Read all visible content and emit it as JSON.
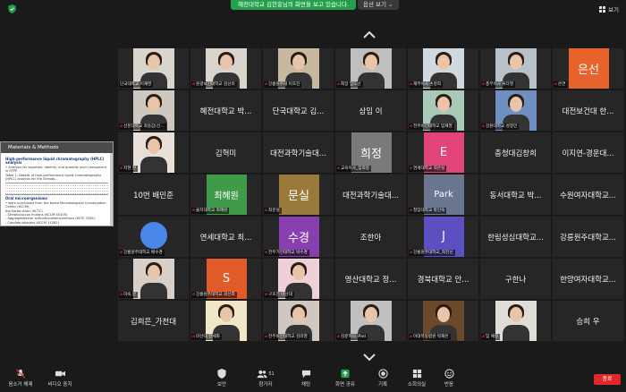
{
  "top": {
    "share_banner": "혜전대학교 김한흥님의 화면을 보고 있습니다.",
    "view_options": "옵션 보기 ⌄",
    "view_button": "보기"
  },
  "shared_screen": {
    "title": "Materials & Methods",
    "heading1": "High-performance liquid chromatography (HPLC) analysis",
    "line1": "• Analysis for separate, identify, and quantify each component in EFPP",
    "line2": "Table 1. Details of high-performance liquid chromatography (HPLC) analysis for the Strepto...",
    "heading2": "Oral microorganisms",
    "line3": "• were purchased from the Korea Microbiological Conservation Center (KCCM),",
    "line4": "the Korea strain (KCTC)",
    "line5": "- Streptococcus mutans (KCCM 40105)",
    "line6": "- Aggregatibacter actinomycetemcomitans (KCTC 2581)",
    "line7": "- Candida albicans (KCCM 11282)",
    "line8": "- Candida albicans (KCCM 11282)"
  },
  "tiles": [
    {
      "type": "photo",
      "label": "단국대학교 이재영",
      "muted": false
    },
    {
      "type": "photo",
      "label": "원광보건대학교 김선미",
      "muted": true
    },
    {
      "type": "photo",
      "label": "강릉원주대 이호진",
      "muted": true,
      "bg": "#c9b8a0"
    },
    {
      "type": "photo",
      "label": "회장 임도선",
      "muted": true,
      "bg": "#bfbfbf"
    },
    {
      "type": "photo",
      "label": "재무이사 손정희",
      "muted": true,
      "bg": "#d0d8e0"
    },
    {
      "type": "photo",
      "label": "총무이사 류다영",
      "muted": true,
      "bg": "#b8c0c8"
    },
    {
      "type": "square",
      "label": "은연",
      "muted": true,
      "letter": "은선",
      "bg": "#e8622b"
    },
    {
      "type": "photo",
      "label": "선문대학교 최용갑(신...",
      "muted": true,
      "bg": "#cfc8c0"
    },
    {
      "type": "name",
      "name": "혜전대학교 박...",
      "label": "",
      "muted": false
    },
    {
      "type": "name",
      "name": "단국대학교 김...",
      "label": "",
      "muted": false
    },
    {
      "type": "name",
      "name": "삼임 이",
      "label": "",
      "muted": false
    },
    {
      "type": "photo",
      "label": "전주비전대학교 임재영",
      "muted": true,
      "bg": "#a8c8b8"
    },
    {
      "type": "photo",
      "label": "강원대학교 성정민",
      "muted": true,
      "bg": "#6e8fbf"
    },
    {
      "type": "name",
      "name": "대전보건대 한...",
      "label": "",
      "muted": false
    },
    {
      "type": "photo",
      "label": "지현 한",
      "muted": true,
      "bg": "#e8e0d6"
    },
    {
      "type": "name",
      "name": "김혁미",
      "label": "",
      "muted": false
    },
    {
      "type": "name",
      "name": "대전과학기술대...",
      "label": "",
      "muted": false
    },
    {
      "type": "square",
      "label": "교육이사_임희정",
      "muted": true,
      "letter": "희정",
      "bg": "#7a7a7a"
    },
    {
      "type": "square",
      "label": "연세대학교 최은실",
      "muted": true,
      "letter": "E",
      "bg": "#e0447a"
    },
    {
      "type": "name",
      "name": "충청대김창희",
      "label": "",
      "muted": false
    },
    {
      "type": "name",
      "name": "이지연-경운대...",
      "label": "",
      "muted": false
    },
    {
      "type": "name",
      "name": "10번 배민준",
      "label": "",
      "muted": false
    },
    {
      "type": "square",
      "label": "을지대학교 최혜원",
      "muted": true,
      "letter": "최혜원",
      "bg": "#3f9a4a"
    },
    {
      "type": "square",
      "label": "최문실",
      "muted": true,
      "letter": "문실",
      "bg": "#9a7a3a"
    },
    {
      "type": "name",
      "name": "대전과학기술대...",
      "label": "",
      "muted": false
    },
    {
      "type": "square",
      "label": "청암대학교 박인숙",
      "muted": true,
      "letter": "Park",
      "bg": "#6a7590"
    },
    {
      "type": "name",
      "name": "동서대학교 박...",
      "label": "",
      "muted": false
    },
    {
      "type": "name",
      "name": "수원여자대학교...",
      "label": "",
      "muted": false
    },
    {
      "type": "circle",
      "label": "강릉원주대학교 배수경",
      "muted": true,
      "bg": "#4a86e8"
    },
    {
      "type": "name",
      "name": "연세대학교 최...",
      "label": "",
      "muted": false
    },
    {
      "type": "square",
      "label": "전주기전대학교 박수경",
      "muted": true,
      "letter": "수경",
      "bg": "#8a3fb0"
    },
    {
      "type": "name",
      "name": "조한아",
      "label": "",
      "muted": false
    },
    {
      "type": "square",
      "label": "강릉원주대학교_최진선",
      "muted": true,
      "letter": "J",
      "bg": "#5b4fc2"
    },
    {
      "type": "name",
      "name": "한림성심대학교...",
      "label": "",
      "muted": false
    },
    {
      "type": "name",
      "name": "강릉원주대학교...",
      "label": "",
      "muted": false
    },
    {
      "type": "photo",
      "label": "미숙 문",
      "muted": true,
      "bg": "#d8d0c8"
    },
    {
      "type": "square",
      "label": "강릉원주대학교 곽선희",
      "muted": true,
      "letter": "S",
      "bg": "#e05a2a"
    },
    {
      "type": "photo",
      "label": "구호진 마산대",
      "muted": true,
      "bg": "#f0d0d8"
    },
    {
      "type": "name",
      "name": "영산대학교 정...",
      "label": "",
      "muted": false
    },
    {
      "type": "name",
      "name": "경북대학교 안...",
      "label": "",
      "muted": false
    },
    {
      "type": "name",
      "name": "구한나",
      "label": "",
      "muted": false
    },
    {
      "type": "name",
      "name": "한양여자대학교...",
      "label": "",
      "muted": false
    },
    {
      "type": "name",
      "name": "김희은_가천대",
      "label": "",
      "muted": false
    },
    {
      "type": "photo",
      "label": "마산대 한세화",
      "muted": true,
      "bg": "#f2e6c8"
    },
    {
      "type": "photo",
      "label": "전주비전대학교 김미영",
      "muted": true,
      "bg": "#d0c8c0"
    },
    {
      "type": "photo",
      "label": "김준혁의 iPad",
      "muted": true,
      "bg": "#c0c0c0"
    },
    {
      "type": "photo",
      "label": "이대목동병원 박재은",
      "muted": true,
      "bg": "#6a4a2a"
    },
    {
      "type": "photo",
      "label": "임 예정",
      "muted": true,
      "bg": "#e0ddd8"
    },
    {
      "type": "name",
      "name": "승희 우",
      "label": "",
      "muted": false
    }
  ],
  "toolbar": {
    "items": [
      {
        "label": "음소거 해제"
      },
      {
        "label": "비디오 중지"
      },
      {
        "label": "보안"
      },
      {
        "label": "참가자",
        "count": "51"
      },
      {
        "label": "채팅"
      },
      {
        "label": "화면 공유"
      },
      {
        "label": "기록"
      },
      {
        "label": "소회의실"
      },
      {
        "label": "반응"
      }
    ],
    "end_label": "종료"
  },
  "colors": {
    "share_green": "#22a04b",
    "end_red": "#e02828",
    "background": "#1a1a1a",
    "tile": "#262626"
  }
}
